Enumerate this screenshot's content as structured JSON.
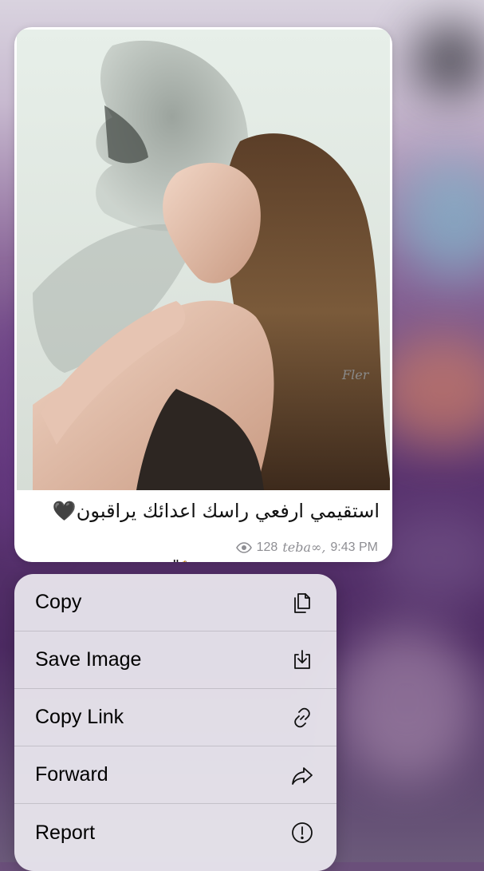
{
  "message": {
    "caption": "استقيمي ارفعي راسك اعدائك يراقبون🖤",
    "second_line": "\"🐆",
    "views": "128",
    "author": "teba∞,",
    "time": "9:43 PM",
    "photo_watermark": "Fler"
  },
  "menu": {
    "items": [
      {
        "label": "Copy",
        "icon": "copy-icon"
      },
      {
        "label": "Save Image",
        "icon": "save-image-icon"
      },
      {
        "label": "Copy Link",
        "icon": "link-icon"
      },
      {
        "label": "Forward",
        "icon": "forward-icon"
      },
      {
        "label": "Report",
        "icon": "report-icon"
      }
    ]
  },
  "colors": {
    "bubble": "#ffffff",
    "meta_text": "#8e8e93",
    "menu_bg": "#eceaf0"
  }
}
